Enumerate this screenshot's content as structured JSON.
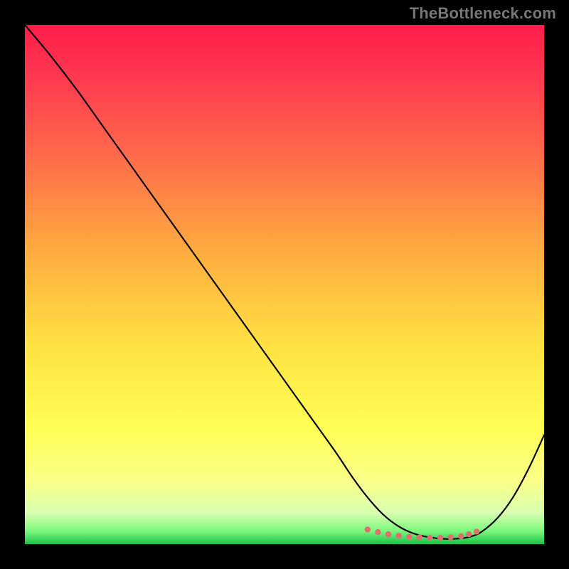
{
  "watermark": "TheBottleneck.com",
  "chart_data": {
    "type": "line",
    "title": "",
    "xlabel": "",
    "ylabel": "",
    "xlim": [
      0,
      100
    ],
    "ylim": [
      0,
      100
    ],
    "background_gradient": {
      "stops": [
        {
          "pos": 0.0,
          "color": "#ff1e4a"
        },
        {
          "pos": 0.1,
          "color": "#ff3850"
        },
        {
          "pos": 0.25,
          "color": "#ff6a4b"
        },
        {
          "pos": 0.45,
          "color": "#ffb03f"
        },
        {
          "pos": 0.62,
          "color": "#ffe243"
        },
        {
          "pos": 0.78,
          "color": "#ffff55"
        },
        {
          "pos": 0.88,
          "color": "#faff8a"
        },
        {
          "pos": 0.94,
          "color": "#d8ffb0"
        },
        {
          "pos": 0.975,
          "color": "#7bf77b"
        },
        {
          "pos": 1.0,
          "color": "#18c24e"
        }
      ]
    },
    "series": [
      {
        "name": "bottleneck-curve",
        "x": [
          0,
          5,
          10,
          15,
          20,
          25,
          30,
          35,
          40,
          45,
          50,
          55,
          60,
          63,
          66,
          69,
          72,
          75,
          78,
          81,
          84,
          86,
          88,
          91,
          94,
          97,
          100
        ],
        "y": [
          100,
          94,
          87.5,
          80.5,
          73.5,
          66.5,
          59.5,
          52.5,
          45.5,
          38.5,
          31.5,
          24.5,
          17.5,
          13,
          9,
          5.7,
          3.4,
          2.0,
          1.3,
          1.0,
          1.1,
          1.5,
          2.4,
          5.0,
          9.0,
          14.5,
          21
        ]
      }
    ],
    "markers": [
      {
        "name": "sweet-spot-points",
        "color": "#e07070",
        "x": [
          66,
          68,
          70,
          72,
          74,
          76,
          78,
          80,
          82,
          84,
          85.5,
          87
        ],
        "y": [
          2.8,
          2.3,
          1.9,
          1.6,
          1.4,
          1.3,
          1.2,
          1.2,
          1.3,
          1.5,
          1.9,
          2.4
        ]
      }
    ]
  }
}
